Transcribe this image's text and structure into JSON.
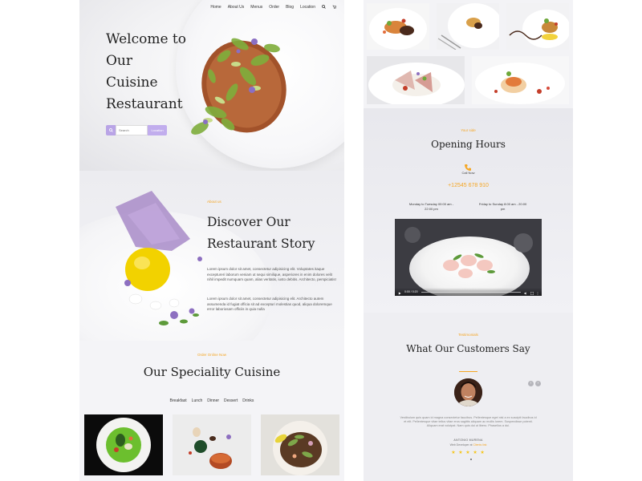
{
  "nav": {
    "items": [
      "Home",
      "About Us",
      "Menus",
      "Order",
      "Blog",
      "Location"
    ],
    "search_icon": "search-icon",
    "cart_icon": "cart-icon"
  },
  "hero": {
    "title_lines": [
      "Welcome to",
      "Our",
      "Cuisine",
      "Restaurant"
    ],
    "search_placeholder": "Search",
    "location_label": "Location"
  },
  "about": {
    "eyebrow": "About us",
    "title_lines": [
      "Discover Our",
      "Restaurant Story"
    ],
    "paragraph1": "Lorem ipsum dolor sit amet, consectetur adipisicing elit. Voluptates itaque exceptureri laborum veniam ut sequi similique, asperiores in enim dolores velit nihil impedit numquam quam, alias veritatis, iusto debitis. Architecto, perspiciatis!",
    "paragraph2": "Lorem ipsum dolor sit amet, consectetur adipisicing elit. Architecto autem assumenda id fugiat officia sit ad excepturi molestias quod, aliqua doloremque error laboriosam officiis in quia nulla"
  },
  "speciality": {
    "eyebrow": "Order Online Now",
    "title": "Our Speciality Cuisine",
    "tabs": [
      "Breakfast",
      "Lunch",
      "Dinner",
      "Dessert",
      "Drinks"
    ]
  },
  "hours": {
    "eyebrow": "Your side",
    "title": "Opening Hours",
    "call_label": "Call Now",
    "phone": "+12545 678 910",
    "schedule": [
      "Monday to Tuesday 00:00 am - 22:00 pm",
      "Friday to Sunday 8:00 am - 20:00 pm"
    ],
    "video_time": "0:00 / 0:20"
  },
  "testimonials": {
    "eyebrow": "Testimonials",
    "title": "What Our Customers Say",
    "quote": "Vestibulum quis quam id magna consectetur faucibus. Pellentesque eget nisl a ex suscipit faucibus id et elit. Pellentesque vitae tellus vitae eros sagittis aliquam ac mollis lorem. Suspendisse potenti. Aliquam erat volutpat. Nam quis dui ut libero. Phasellus a dui.",
    "author": "ANTONIO MURENA",
    "role_prefix": "Web Developer at",
    "role_link": "Clients link",
    "stars": "★ ★ ★ ★ ★"
  },
  "colors": {
    "accent_orange": "#f5a623",
    "accent_purple": "#b9a4e6",
    "star_yellow": "#f5c518"
  }
}
